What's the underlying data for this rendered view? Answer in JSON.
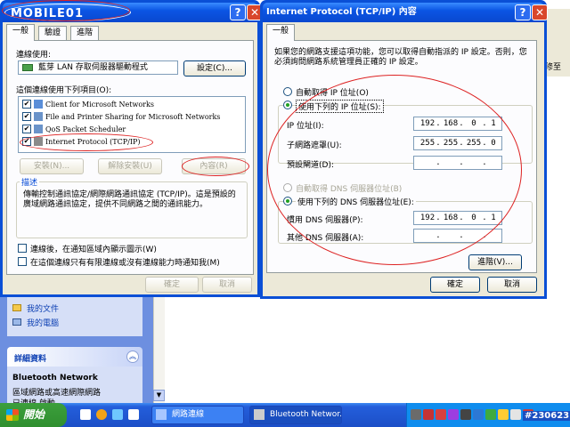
{
  "watermark_id": "#230623",
  "sidebar": {
    "links": [
      "我的文件",
      "我的電腦"
    ],
    "details_title": "詳細資料",
    "details_name": "Bluetooth Network",
    "details_desc": "區域網路或高速網際網路",
    "details_trunc": "已連線  啟動"
  },
  "right_strip": {
    "text": "修至"
  },
  "left_dialog": {
    "tabs": [
      "一般",
      "驗證",
      "進階"
    ],
    "connect_using_label": "連線使用:",
    "adapter_name": "藍芽 LAN 存取伺服器驅動程式",
    "configure_button": "設定(C)...",
    "items_label": "這個連線使用下列項目(O):",
    "items": [
      "Client for Microsoft Networks",
      "File and Printer Sharing for Microsoft Networks",
      "QoS Packet Scheduler",
      "Internet Protocol (TCP/IP)"
    ],
    "install_button": "安裝(N)...",
    "uninstall_button": "解除安裝(U)",
    "properties_button": "內容(R)",
    "description_title": "描述",
    "description_text": "傳輸控制通訊協定/網際網路通訊協定 (TCP/IP)。這是預設的廣域網路通訊協定，提供不同網路之間的通訊能力。",
    "show_icon_label": "連線後，在通知區域內顯示圖示(W)",
    "notify_label": "在這個連線只有有限連線或沒有連線能力時通知我(M)",
    "ok_button": "確定",
    "cancel_button": "取消"
  },
  "tcp_dialog": {
    "title": "Internet Protocol (TCP/IP) 內容",
    "tab": "一般",
    "intro": "如果您的網路支援這項功能，您可以取得自動指派的 IP 設定。否則，您必須詢問網路系統管理員正確的 IP 設定。",
    "auto_ip_label": "自動取得 IP 位址(O)",
    "use_ip_label": "使用下列的 IP 位址(S):",
    "ip_label": "IP 位址(I):",
    "ip_value": [
      "192",
      "168",
      "0",
      "1"
    ],
    "subnet_label": "子網路遮罩(U):",
    "subnet_value": [
      "255",
      "255",
      "255",
      "0"
    ],
    "gateway_label": "預設閘道(D):",
    "auto_dns_label": "自動取得 DNS 伺服器位址(B)",
    "use_dns_label": "使用下列的 DNS 伺服器位址(E):",
    "pref_dns_label": "慣用 DNS 伺服器(P):",
    "pref_dns_value": [
      "192",
      "168",
      "0",
      "1"
    ],
    "alt_dns_label": "其他 DNS 伺服器(A):",
    "advanced_button": "進階(V)...",
    "ok_button": "確定",
    "cancel_button": "取消"
  },
  "taskbar": {
    "start": "開始",
    "items": [
      "網路連線",
      "Bluetooth Networ..."
    ]
  }
}
